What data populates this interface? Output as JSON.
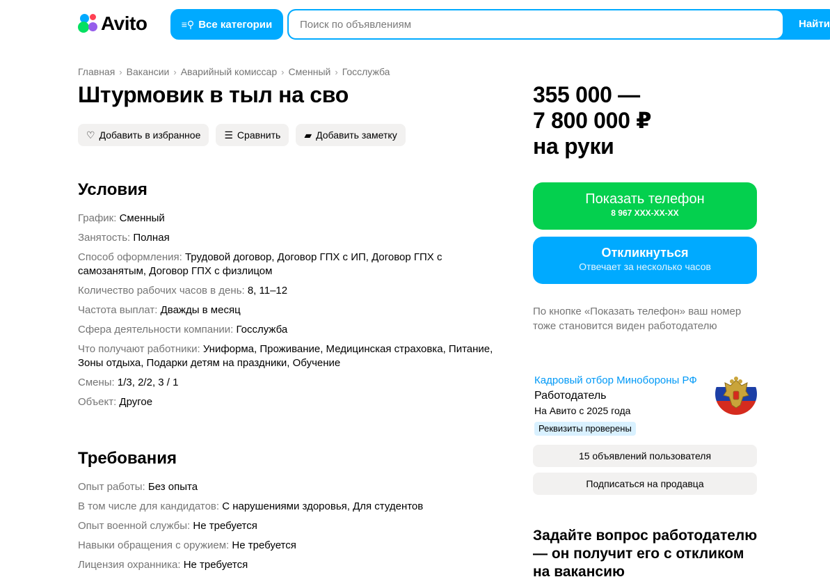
{
  "header": {
    "logo_text": "Avito",
    "categories_label": "Все категории",
    "search_placeholder": "Поиск по объявлениям",
    "search_button": "Найти"
  },
  "breadcrumbs": [
    "Главная",
    "Вакансии",
    "Аварийный комиссар",
    "Сменный",
    "Госслужба"
  ],
  "listing": {
    "title": "Штурмовик в тыл на сво",
    "actions": {
      "favorite": "Добавить в избранное",
      "compare": "Сравнить",
      "note": "Добавить заметку"
    }
  },
  "conditions": {
    "heading": "Условия",
    "rows": [
      {
        "k": "График:",
        "v": "Сменный"
      },
      {
        "k": "Занятость:",
        "v": "Полная"
      },
      {
        "k": "Способ оформления:",
        "v": "Трудовой договор, Договор ГПХ с ИП, Договор ГПХ с самозанятым, Договор ГПХ с физлицом"
      },
      {
        "k": "Количество рабочих часов в день:",
        "v": "8, 11–12"
      },
      {
        "k": "Частота выплат:",
        "v": "Дважды в месяц"
      },
      {
        "k": "Сфера деятельности компании:",
        "v": "Госслужба"
      },
      {
        "k": "Что получают работники:",
        "v": "Униформа, Проживание, Медицинская страховка, Питание, Зоны отдыха, Подарки детям на праздники, Обучение"
      },
      {
        "k": "Смены:",
        "v": "1/3, 2/2, 3 / 1"
      },
      {
        "k": "Объект:",
        "v": "Другое"
      }
    ]
  },
  "requirements": {
    "heading": "Требования",
    "rows": [
      {
        "k": "Опыт работы:",
        "v": "Без опыта"
      },
      {
        "k": "В том числе для кандидатов:",
        "v": "С нарушениями здоровья, Для студентов"
      },
      {
        "k": "Опыт военной службы:",
        "v": "Не требуется"
      },
      {
        "k": "Навыки обращения с оружием:",
        "v": "Не требуется"
      },
      {
        "k": "Лицензия охранника:",
        "v": "Не требуется"
      }
    ]
  },
  "sidebar": {
    "price_line1": "355 000 —",
    "price_line2": "7 800 000 ₽",
    "price_line3": "на руки",
    "show_phone_label": "Показать телефон",
    "phone_masked": "8 967 XXX-XX-XX",
    "reply_label": "Откликнуться",
    "reply_sub": "Отвечает за несколько часов",
    "hint": "По кнопке «Показать телефон» ваш номер тоже становится виден работодателю",
    "seller": {
      "name": "Кадровый отбор Минобороны РФ",
      "role": "Работодатель",
      "since": "На Авито с 2025 года",
      "badge": "Реквизиты проверены"
    },
    "listings_count_label": "15 объявлений пользователя",
    "subscribe_label": "Подписаться на продавца",
    "ask_heading": "Задайте вопрос работодателю — он получит его с откликом на вакансию"
  },
  "colors": {
    "accent_blue": "#00aaff",
    "phone_green": "#04d04e",
    "link_blue": "#0099f7",
    "muted_text": "#757575",
    "chip_bg": "#f2f1f0"
  }
}
